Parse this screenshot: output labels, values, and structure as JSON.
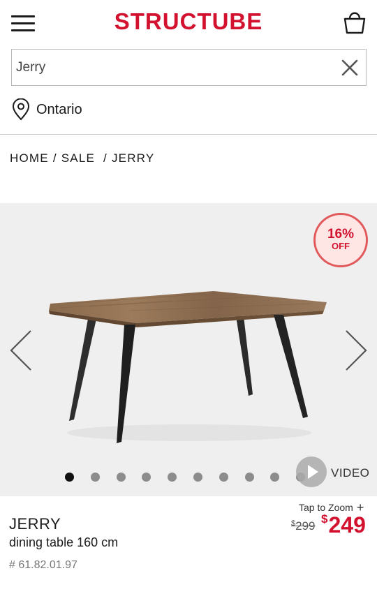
{
  "header": {
    "logo": "STRUCTUBE"
  },
  "search": {
    "value": "Jerry"
  },
  "location": {
    "label": "Ontario"
  },
  "breadcrumb": {
    "home": "HOME",
    "sale": "SALE",
    "current": "JERRY",
    "separator": "/"
  },
  "gallery": {
    "badge_percent": "16%",
    "badge_off": "OFF",
    "dot_count": 10,
    "active_dot": 0,
    "video_label": "VIDEO"
  },
  "product": {
    "zoom_label": "Tap to Zoom",
    "zoom_plus": "+",
    "name": "JERRY",
    "description": "dining table 160 cm",
    "sku": "# 61.82.01.97",
    "old_price_symbol": "$",
    "old_price": "299",
    "new_price_symbol": "$",
    "new_price": "249"
  },
  "colors": {
    "brand_red": "#d2122e",
    "badge_bg": "#fde6e4",
    "gallery_bg": "#efefef"
  },
  "icons": [
    "menu-icon",
    "cart-icon",
    "close-icon",
    "location-pin-icon",
    "chevron-left-icon",
    "chevron-right-icon",
    "play-icon"
  ]
}
